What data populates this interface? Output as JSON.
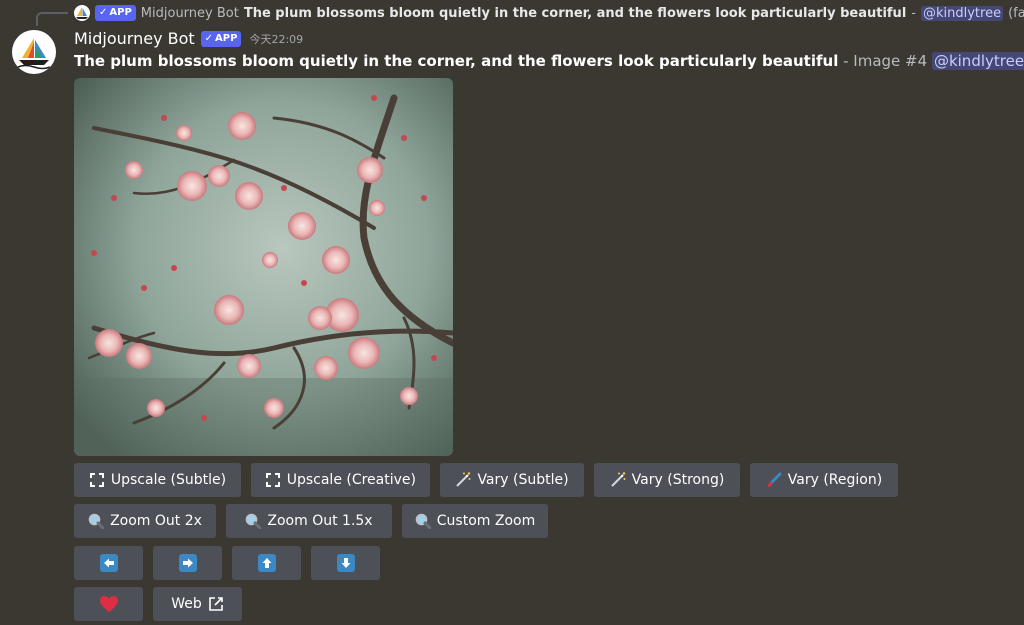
{
  "reply": {
    "author": "Midjourney Bot",
    "badge": "APP",
    "text": "The plum blossoms bloom quietly in the corner, and the flowers look particularly beautiful",
    "dash": "-",
    "mention": "@kindlytree",
    "speed": "(fast)"
  },
  "message": {
    "author": "Midjourney Bot",
    "badge": "APP",
    "timestamp": "今天22:09",
    "prompt": "The plum blossoms bloom quietly in the corner, and the flowers look particularly beautiful",
    "meta": "- Image #4",
    "mention": "@kindlytree"
  },
  "buttons": {
    "row1": {
      "upscale_subtle": "Upscale (Subtle)",
      "upscale_creative": "Upscale (Creative)",
      "vary_subtle": "Vary (Subtle)",
      "vary_strong": "Vary (Strong)",
      "vary_region": "Vary (Region)"
    },
    "row2": {
      "zoom_out_2x": "Zoom Out 2x",
      "zoom_out_1_5x": "Zoom Out 1.5x",
      "custom_zoom": "Custom Zoom"
    },
    "row4": {
      "web": "Web"
    }
  },
  "icons": {
    "expand": "expand-arrows-icon",
    "magic_wand": "magic-wand-icon",
    "brush": "paintbrush-icon",
    "magnifier": "magnifier-icon",
    "arrow_left": "arrow-left-icon",
    "arrow_right": "arrow-right-icon",
    "arrow_up": "arrow-up-icon",
    "arrow_down": "arrow-down-icon",
    "heart": "heart-icon",
    "external": "external-link-icon",
    "image": "image-icon"
  },
  "colors": {
    "background": "#3b3832",
    "button": "#4e5058",
    "badge": "#5865f2",
    "arrow": "#3b88c3",
    "heart": "#dd2e44"
  }
}
